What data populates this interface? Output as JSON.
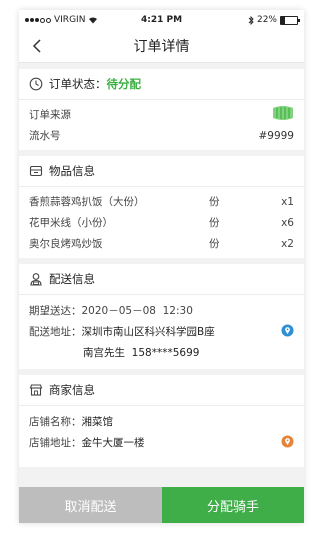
{
  "status_bar": {
    "carrier": "VIRGIN",
    "time": "4:21 PM",
    "battery": "22%",
    "battery_level": 0.22
  },
  "nav": {
    "title": "订单详情"
  },
  "order_status": {
    "label": "订单状态：",
    "value": "待分配",
    "value_color": "#3cb043",
    "source_label": "订单来源",
    "serial_label": "流水号",
    "serial_value": "#9999"
  },
  "goods": {
    "title": "物品信息",
    "items": [
      {
        "name": "香煎蒜蓉鸡扒饭（大份）",
        "unit": "份",
        "qty": "x1"
      },
      {
        "name": "花甲米线（小份）",
        "unit": "份",
        "qty": "x6"
      },
      {
        "name": "奥尔良烤鸡炒饭",
        "unit": "份",
        "qty": "x2"
      }
    ]
  },
  "delivery": {
    "title": "配送信息",
    "expected_label": "期望送达：",
    "expected_value": "2020－05－08  12:30",
    "address_label": "配送地址：",
    "address_value": "深圳市南山区科兴科学园B座",
    "contact": "南宫先生  158****5699"
  },
  "merchant": {
    "title": "商家信息",
    "name_label": "店铺名称：",
    "name_value": "湘菜馆",
    "address_label": "店铺地址：",
    "address_value": "金牛大厦一楼"
  },
  "actions": {
    "cancel": "取消配送",
    "assign": "分配骑手"
  },
  "colors": {
    "accent_green": "#3fae49",
    "cancel_gray": "#bdbdbd",
    "pin_blue": "#2d8fd5",
    "pin_orange": "#e8833a"
  },
  "icons": [
    "clock-icon",
    "source-logo-icon",
    "package-icon",
    "courier-icon",
    "store-icon",
    "location-pin-icon"
  ]
}
